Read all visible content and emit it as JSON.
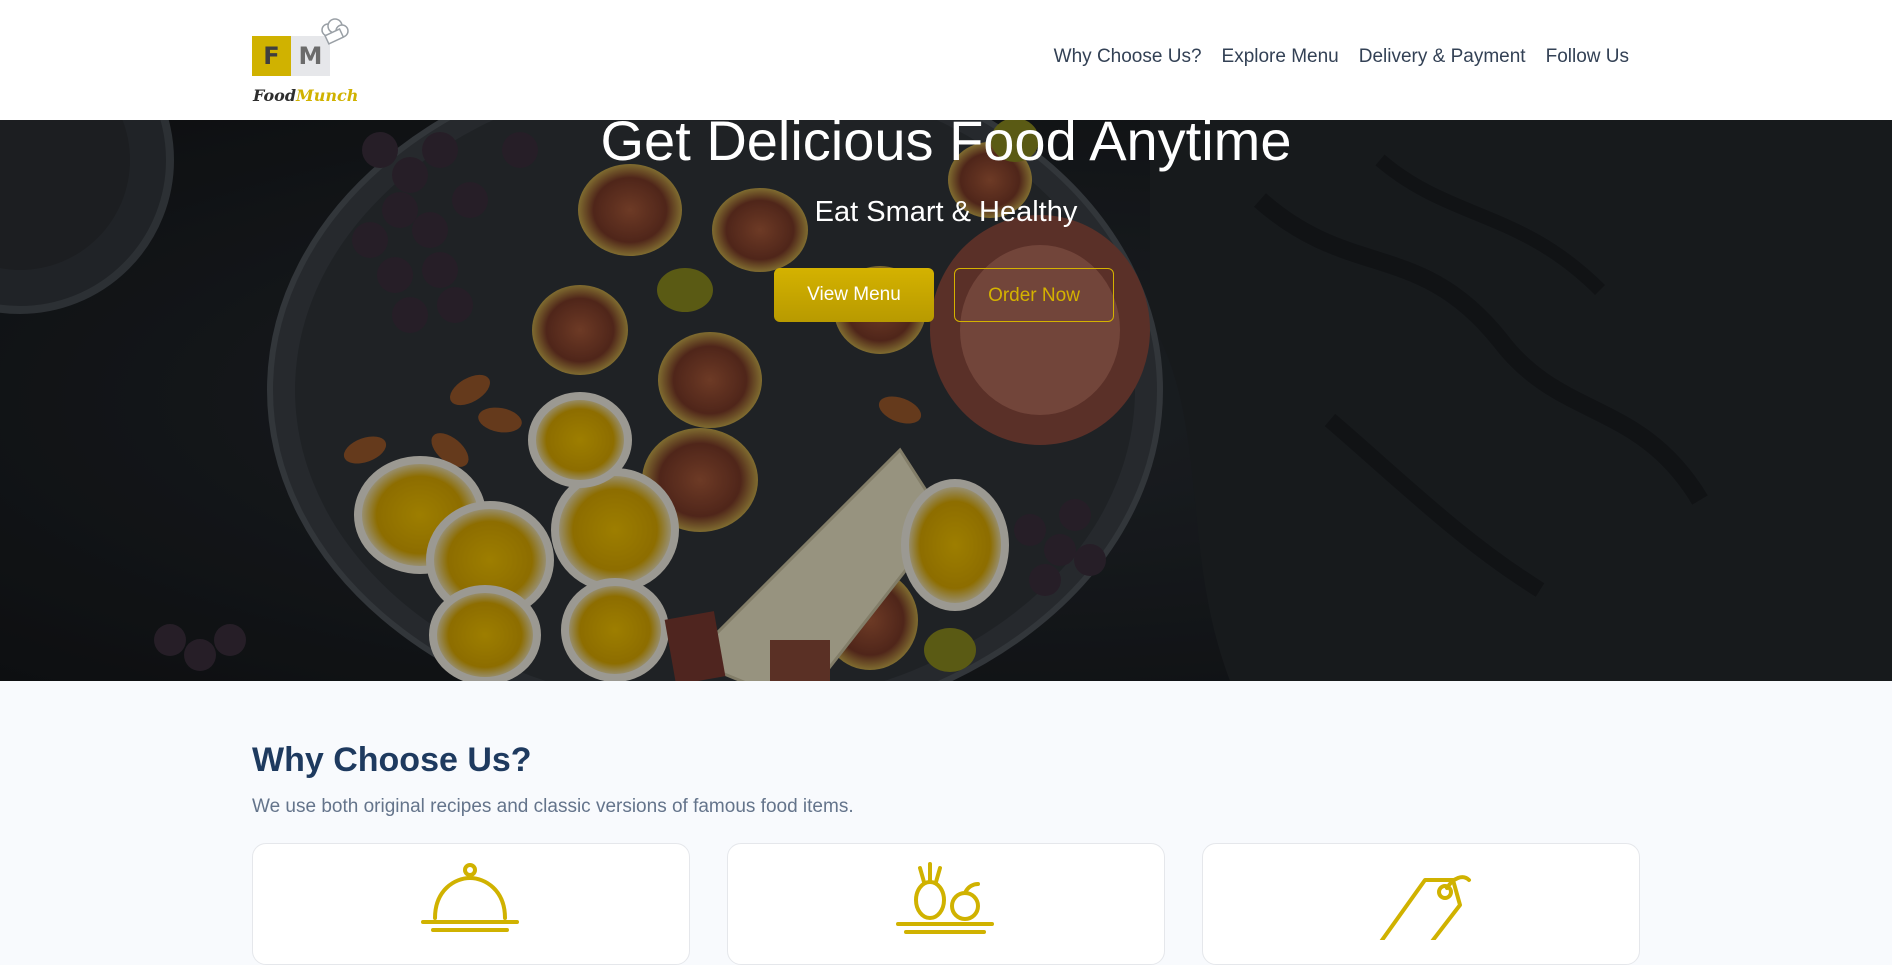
{
  "brand": {
    "logo_letters": [
      "F",
      "M"
    ],
    "name_part1": "Food",
    "name_part2": "Munch",
    "accent_color": "#d0b200"
  },
  "nav": {
    "items": [
      {
        "label": "Why Choose Us?"
      },
      {
        "label": "Explore Menu"
      },
      {
        "label": "Delivery & Payment"
      },
      {
        "label": "Follow Us"
      }
    ]
  },
  "hero": {
    "title": "Get Delicious Food Anytime",
    "subtitle": "Eat Smart & Healthy",
    "primary_button": "View Menu",
    "secondary_button": "Order Now"
  },
  "why": {
    "heading": "Why Choose Us?",
    "description": "We use both original recipes and classic versions of famous food items.",
    "cards": [
      {
        "icon": "food-cloche-icon"
      },
      {
        "icon": "fresh-produce-icon"
      },
      {
        "icon": "price-tag-icon"
      }
    ]
  }
}
